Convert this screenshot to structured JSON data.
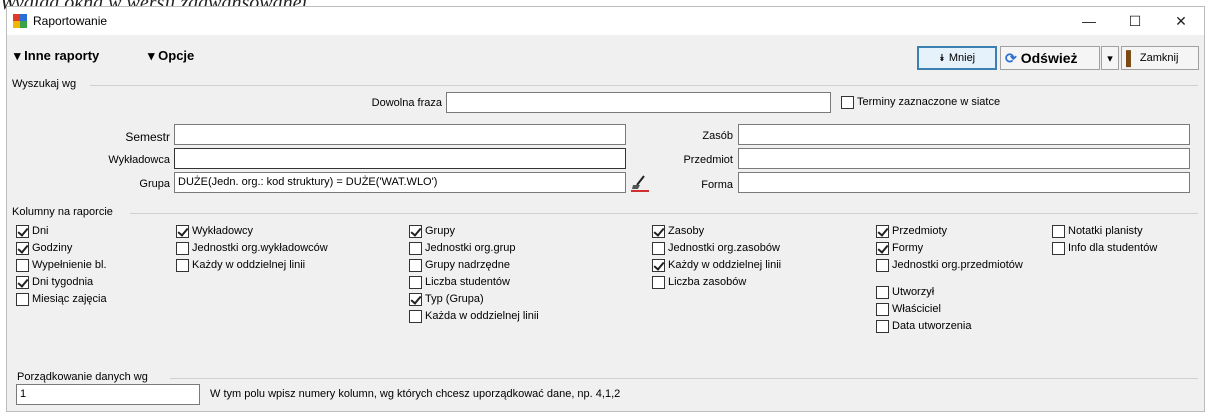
{
  "caption": "Wygląd okna w wersji zaawansowanej",
  "window": {
    "title": "Raportowanie",
    "minimize": "—",
    "maximize": "☐",
    "close": "✕"
  },
  "toolbar": {
    "other_reports": "Inne raporty",
    "options": "Opcje",
    "less": "Mniej",
    "refresh": "Odśwież",
    "close": "Zamknij"
  },
  "search": {
    "group_label": "Wyszukaj wg",
    "phrase_label": "Dowolna fraza",
    "phrase_value": "",
    "terms_checkbox": "Terminy zaznaczone w siatce",
    "terms_checked": false,
    "semester_label": "Semestr",
    "semester_value": "",
    "lecturer_label": "Wykładowca",
    "lecturer_value": "",
    "group_field_label": "Grupa",
    "group_field_value": "DUŻE(Jedn. org.: kod struktury) = DUŻE('WAT.WLO')",
    "resource_label": "Zasób",
    "resource_value": "",
    "subject_label": "Przedmiot",
    "subject_value": "",
    "form_label": "Forma",
    "form_value": ""
  },
  "columns": {
    "group_label": "Kolumny na raporcie",
    "col1": [
      {
        "label": "Dni",
        "checked": true
      },
      {
        "label": "Godziny",
        "checked": true
      },
      {
        "label": "Wypełnienie bl.",
        "checked": false
      },
      {
        "label": "Dni tygodnia",
        "checked": true
      },
      {
        "label": "Miesiąc zajęcia",
        "checked": false
      }
    ],
    "col2": [
      {
        "label": "Wykładowcy",
        "checked": true
      },
      {
        "label": "Jednostki org.wykładowców",
        "checked": false
      },
      {
        "label": "Każdy w oddzielnej linii",
        "checked": false
      }
    ],
    "col3": [
      {
        "label": "Grupy",
        "checked": true
      },
      {
        "label": "Jednostki org.grup",
        "checked": false
      },
      {
        "label": "Grupy nadrzędne",
        "checked": false
      },
      {
        "label": "Liczba studentów",
        "checked": false
      },
      {
        "label": "Typ (Grupa)",
        "checked": true
      },
      {
        "label": "Każda w oddzielnej linii",
        "checked": false
      }
    ],
    "col4": [
      {
        "label": "Zasoby",
        "checked": true
      },
      {
        "label": "Jednostki org.zasobów",
        "checked": false
      },
      {
        "label": "Każdy w oddzielnej linii",
        "checked": true
      },
      {
        "label": "Liczba zasobów",
        "checked": false
      }
    ],
    "col5": [
      {
        "label": "Przedmioty",
        "checked": true
      },
      {
        "label": "Formy",
        "checked": true
      },
      {
        "label": "Jednostki org.przedmiotów",
        "checked": false
      }
    ],
    "col5b": [
      {
        "label": "Utworzył",
        "checked": false
      },
      {
        "label": "Właściciel",
        "checked": false
      },
      {
        "label": "Data utworzenia",
        "checked": false
      }
    ],
    "col6": [
      {
        "label": "Notatki planisty",
        "checked": false
      },
      {
        "label": "Info dla studentów",
        "checked": false
      }
    ]
  },
  "order": {
    "group_label": "Porządkowanie danych wg",
    "value": "1",
    "hint": "W tym polu wpisz numery kolumn, wg których chcesz uporządkować dane, np. 4,1,2"
  }
}
